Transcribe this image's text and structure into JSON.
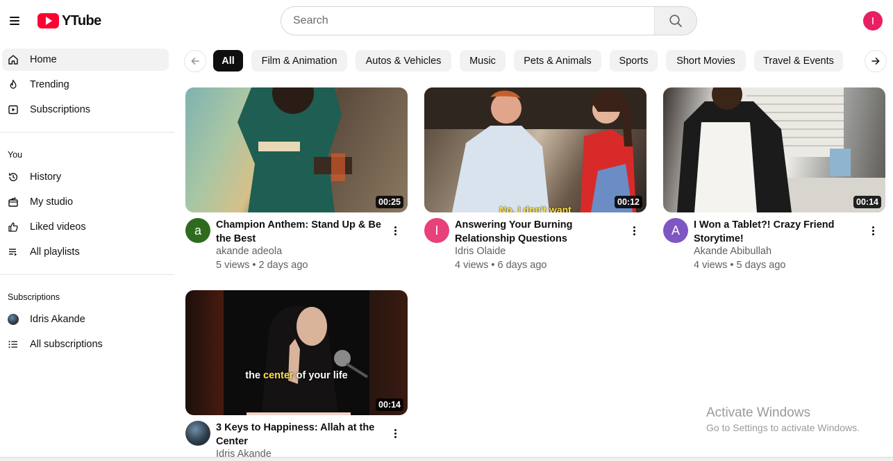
{
  "header": {
    "logo_text": "YTube",
    "search_placeholder": "Search",
    "avatar_letter": "I",
    "avatar_color": "#e81f63",
    "brand_color": "#ff0033"
  },
  "sidebar": {
    "main": [
      {
        "label": "Home",
        "icon": "home-icon",
        "active": true
      },
      {
        "label": "Trending",
        "icon": "flame-icon"
      },
      {
        "label": "Subscriptions",
        "icon": "subscriptions-icon"
      }
    ],
    "you_heading": "You",
    "you": [
      {
        "label": "History",
        "icon": "history-icon"
      },
      {
        "label": "My studio",
        "icon": "studio-icon"
      },
      {
        "label": "Liked videos",
        "icon": "thumbs-up-icon"
      },
      {
        "label": "All playlists",
        "icon": "playlist-icon"
      }
    ],
    "subscriptions_heading": "Subscriptions",
    "subscriptions": [
      {
        "label": "Idris Akande",
        "icon": "channel-avatar"
      },
      {
        "label": "All subscriptions",
        "icon": "list-icon"
      }
    ]
  },
  "chips": [
    "All",
    "Film & Animation",
    "Autos & Vehicles",
    "Music",
    "Pets & Animals",
    "Sports",
    "Short Movies",
    "Travel & Events"
  ],
  "videos": [
    {
      "title": "Champion Anthem: Stand Up & Be the Best",
      "channel": "akande adeola",
      "views": "5 views",
      "age": "2 days ago",
      "duration": "00:25",
      "avatar_letter": "a",
      "avatar_color": "#2e6b1f"
    },
    {
      "title": "Answering Your Burning Relationship Questions",
      "channel": "Idris Olaide",
      "views": "4 views",
      "age": "6 days ago",
      "duration": "00:12",
      "avatar_letter": "I",
      "avatar_color": "#e8407a",
      "caption": "No, I don't want"
    },
    {
      "title": "I Won a Tablet?! Crazy Friend Storytime!",
      "channel": "Akande Abibullah",
      "views": "4 views",
      "age": "5 days ago",
      "duration": "00:14",
      "avatar_letter": "A",
      "avatar_color": "#7e57c2"
    },
    {
      "title": "3 Keys to Happiness: Allah at the Center",
      "channel": "Idris Akande",
      "duration": "00:14",
      "caption_pre": "the ",
      "caption_highlight": "center",
      "caption_post": " of your life"
    }
  ],
  "watermark": {
    "line1": "Activate Windows",
    "line2": "Go to Settings to activate Windows."
  }
}
